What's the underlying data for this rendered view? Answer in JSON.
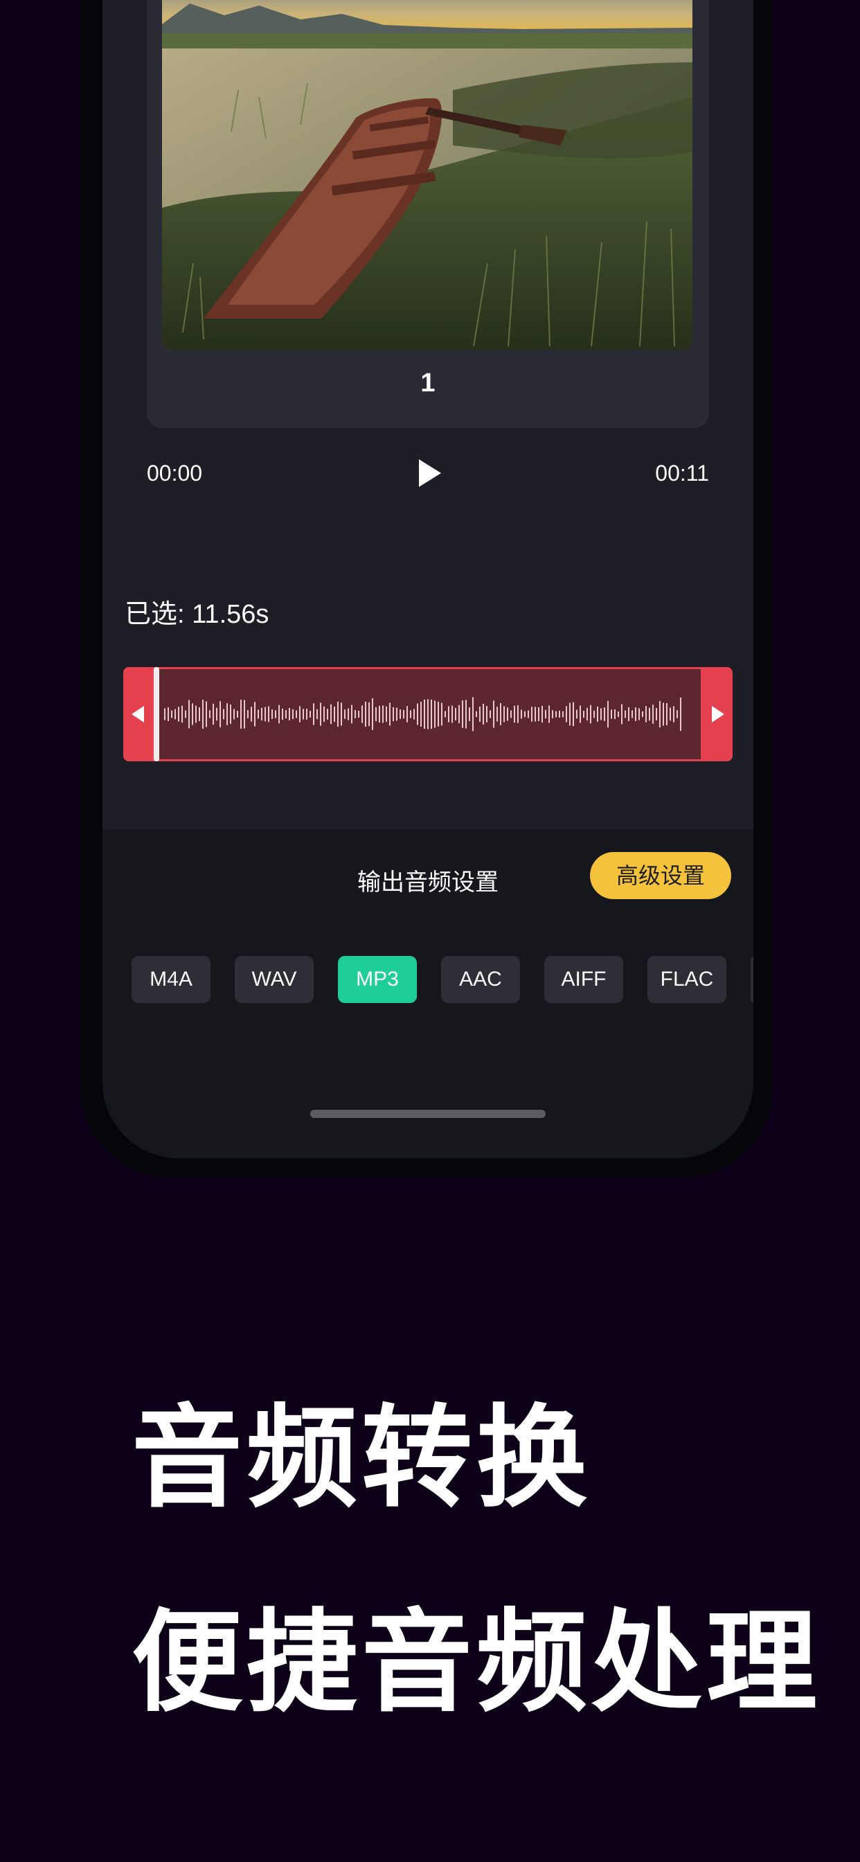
{
  "preview": {
    "page_number": "1"
  },
  "player": {
    "current_time": "00:00",
    "total_time": "00:11",
    "play_icon": "play-icon"
  },
  "trim": {
    "selected_label": "已选: 11.56s",
    "left_handle_icon": "triangle-left-icon",
    "right_handle_icon": "triangle-right-icon"
  },
  "output": {
    "title": "输出音频设置",
    "advanced_button": "高级设置",
    "formats": [
      "M4A",
      "WAV",
      "MP3",
      "AAC",
      "AIFF",
      "FLAC"
    ],
    "selected_format": "MP3"
  },
  "promo": {
    "headline": "音频转换",
    "subheadline": "便捷音频处理"
  },
  "colors": {
    "background": "#0c0118",
    "accent_red": "#e6414e",
    "accent_green": "#1fcd96",
    "accent_yellow": "#f5c33b"
  }
}
